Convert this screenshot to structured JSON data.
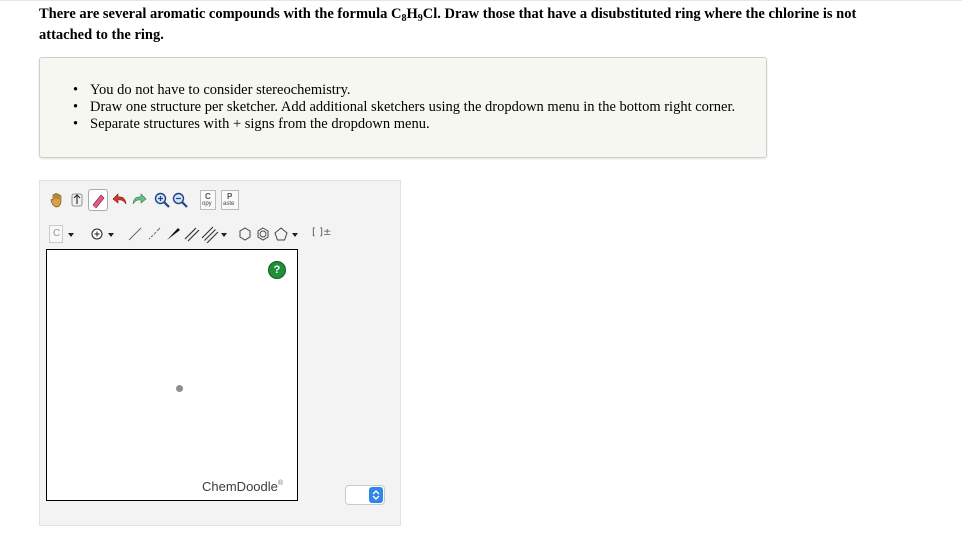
{
  "question": {
    "part1": "There are several aromatic compounds with the formula C",
    "sub1": "8",
    "mid1": "H",
    "sub2": "9",
    "part2": "Cl. Draw those that have a disubstituted ring where the chlorine is not attached to the ring."
  },
  "instructions": {
    "items": [
      "You do not have to consider stereochemistry.",
      "Draw one structure per sketcher. Add additional sketchers using the dropdown menu in the bottom right corner.",
      "Separate structures with + signs from the dropdown menu."
    ]
  },
  "sketcher": {
    "toolbar_row1": {
      "copy_label_top": "C",
      "copy_label_bottom": "opy",
      "paste_label_top": "P",
      "paste_label_bottom": "aste"
    },
    "toolbar_row2": {
      "element_label": "C",
      "bracket_label": "[ ]±"
    },
    "help_label": "?",
    "brand": "ChemDoodle",
    "brand_mark": "®",
    "colors": {
      "help_green": "#1f8f3a",
      "select_blue": "#2f86e8",
      "eraser_pink": "#e05a8a"
    }
  }
}
